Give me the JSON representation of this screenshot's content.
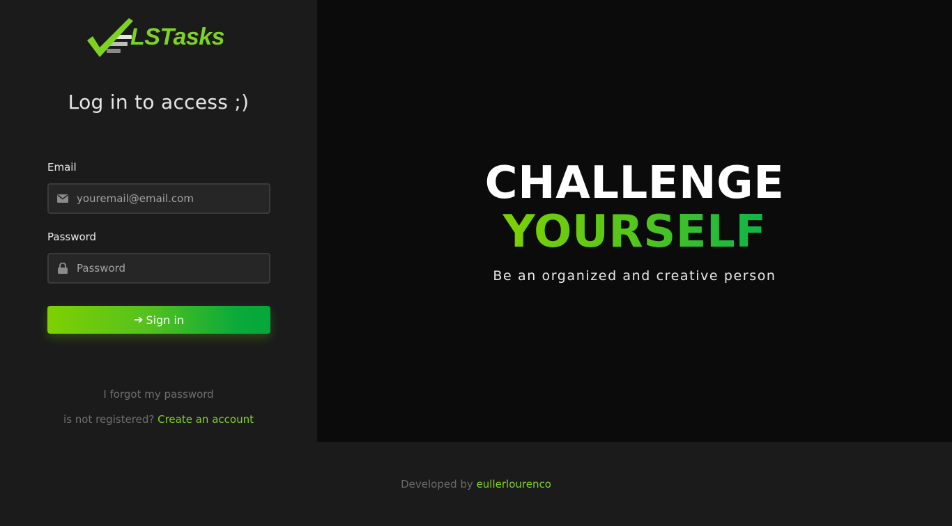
{
  "brand": {
    "name": "LSTasks",
    "accent": "#7ed321",
    "logo_icon": "checkmark-icon"
  },
  "login": {
    "title": "Log in to access ;)",
    "email": {
      "label": "Email",
      "placeholder": "youremail@email.com",
      "value": "",
      "icon": "envelope-icon"
    },
    "password": {
      "label": "Password",
      "placeholder": "Password",
      "value": "",
      "icon": "lock-icon"
    },
    "signin_label": "Sign in",
    "signin_icon": "arrow-right-icon",
    "forgot_label": "I forgot my password",
    "register_prefix": "is not registered?",
    "register_link": "Create an account"
  },
  "hero": {
    "line1": "CHALLENGE",
    "line2": "YOURSELF",
    "tagline": "Be an organized and creative person"
  },
  "footer": {
    "prefix": "Developed by",
    "author": "eullerlourenco"
  },
  "colors": {
    "panel_bg": "#1b1b1b",
    "hero_bg": "#0b0b0b",
    "gradient_start": "#7ed100",
    "gradient_end": "#05a73a"
  }
}
